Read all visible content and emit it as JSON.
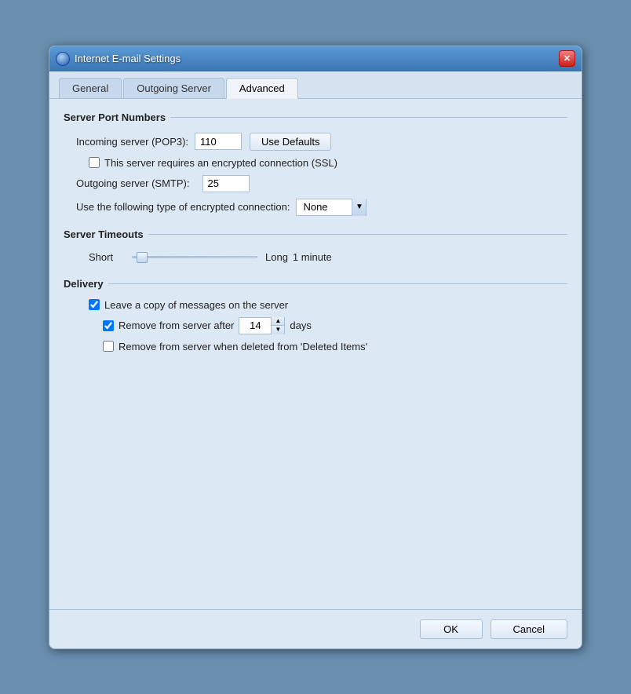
{
  "window": {
    "title": "Internet E-mail Settings",
    "close_label": "✕"
  },
  "tabs": [
    {
      "id": "general",
      "label": "General",
      "active": false
    },
    {
      "id": "outgoing-server",
      "label": "Outgoing Server",
      "active": false
    },
    {
      "id": "advanced",
      "label": "Advanced",
      "active": true
    }
  ],
  "sections": {
    "server_port_numbers": {
      "title": "Server Port Numbers",
      "incoming_label": "Incoming server (POP3):",
      "incoming_value": "110",
      "use_defaults_label": "Use Defaults",
      "ssl_checkbox_label": "This server requires an encrypted connection (SSL)",
      "ssl_checked": false,
      "outgoing_label": "Outgoing server (SMTP):",
      "outgoing_value": "25",
      "encrypted_label": "Use the following type of encrypted connection:",
      "encrypted_value": "None"
    },
    "server_timeouts": {
      "title": "Server Timeouts",
      "short_label": "Short",
      "long_label": "Long",
      "timeout_value": "1 minute"
    },
    "delivery": {
      "title": "Delivery",
      "leave_copy_label": "Leave a copy of messages on the server",
      "leave_copy_checked": true,
      "remove_after_label": "Remove from server after",
      "remove_after_checked": true,
      "remove_days_value": "14",
      "remove_days_suffix": "days",
      "remove_deleted_label": "Remove from server when deleted from 'Deleted Items'",
      "remove_deleted_checked": false
    }
  },
  "footer": {
    "ok_label": "OK",
    "cancel_label": "Cancel"
  }
}
